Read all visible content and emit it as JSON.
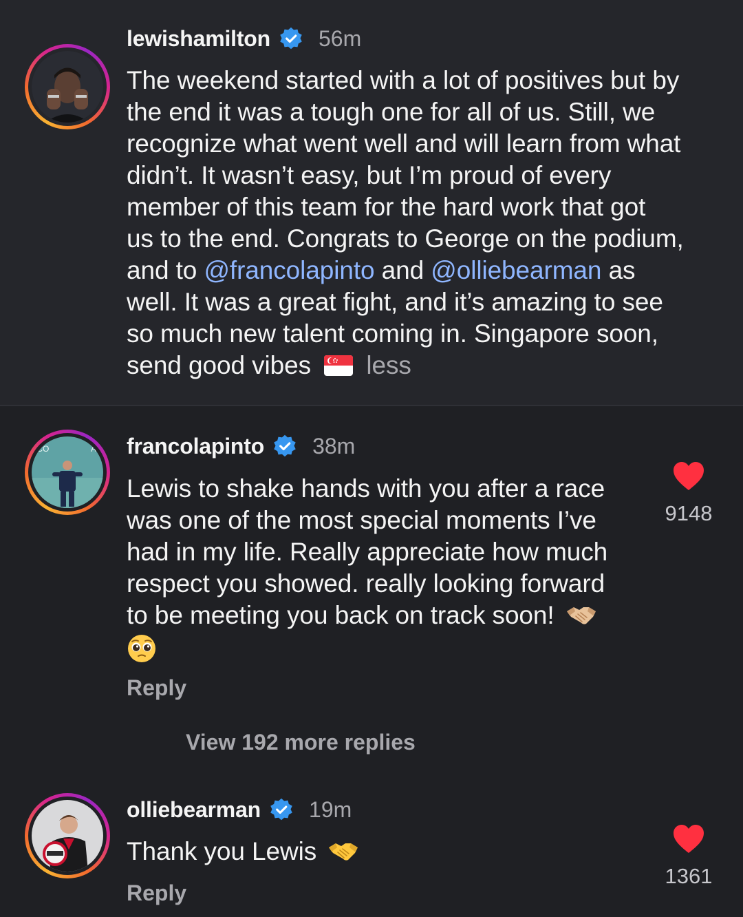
{
  "post": {
    "username": "lewishamilton",
    "time": "56m",
    "lines": [
      "The weekend started with a lot of positives but by",
      "the end it was a tough one for all of us. Still, we",
      "recognize what went well and will learn from what",
      "didn’t. It wasn’t easy, but I’m proud of every",
      "member of this team for the hard work that got",
      "us to the end. Congrats to George on the podium,"
    ],
    "line7_pre": "and to ",
    "mention1": "@francolapinto",
    "line7_mid": " and ",
    "mention2": "@olliebearman",
    "line7_post": " as",
    "line8": "well. It was a great fight, and it’s amazing to see",
    "line9": "so much new talent coming in. Singapore soon,",
    "line10": "send good vibes",
    "flag_icon": "singapore-flag-icon",
    "less_label": "less"
  },
  "comments": [
    {
      "username": "francolapinto",
      "time": "38m",
      "lines": [
        "Lewis to shake hands with you after a race",
        "was one of the most special moments I’ve",
        "had in my life. Really appreciate how much",
        "respect you showed. really looking forward",
        "to be meeting you back on track soon!"
      ],
      "emojis": [
        "handshake-icon",
        "pleading-face-icon"
      ],
      "likes": "9148",
      "reply_label": "Reply",
      "view_more_label": "View 192 more replies"
    },
    {
      "username": "olliebearman",
      "time": "19m",
      "lines": [
        "Thank you Lewis"
      ],
      "emojis": [
        "handshake-icon"
      ],
      "likes": "1361",
      "reply_label": "Reply"
    }
  ],
  "colors": {
    "background_post": "#25262b",
    "background_comments": "#1f2024",
    "mention": "#8fb6ff",
    "heart": "#ff3040",
    "verified": "#3797f0",
    "muted": "#a8a8ad"
  }
}
